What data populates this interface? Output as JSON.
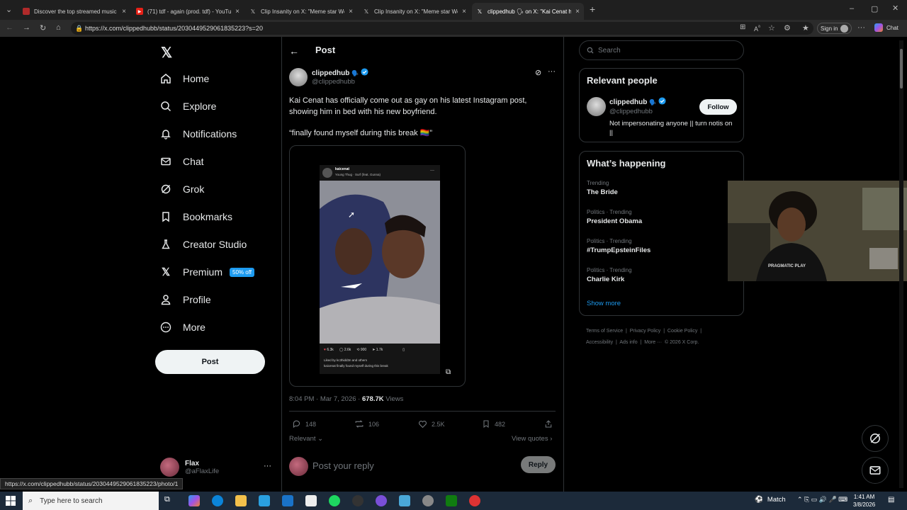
{
  "browser": {
    "tabs": [
      {
        "title": "Discover the top streamed music",
        "icon": "music-icon"
      },
      {
        "title": "(71) tdf - again (prod. tdf) - YouTu",
        "icon": "youtube-icon"
      },
      {
        "title": "Clip Insanity on X: \"Meme star We",
        "icon": "x-logo-icon"
      },
      {
        "title": "Clip Insanity on X: \"Meme star We",
        "icon": "x-logo-icon"
      },
      {
        "title": "clippedhub 🗣 on X: \"Kai Cenat h",
        "icon": "x-logo-icon"
      }
    ],
    "url": "https://x.com/clippedhubb/status/2030449529061835223?s=20",
    "signin_label": "Sign in",
    "chat_label": "Chat",
    "status_url": "https://x.com/clippedhubb/status/2030449529061835223/photo/1"
  },
  "nav": {
    "items": [
      {
        "label": "Home",
        "icon": "home-icon"
      },
      {
        "label": "Explore",
        "icon": "search-icon"
      },
      {
        "label": "Notifications",
        "icon": "bell-icon"
      },
      {
        "label": "Chat",
        "icon": "mail-icon"
      },
      {
        "label": "Grok",
        "icon": "grok-icon"
      },
      {
        "label": "Bookmarks",
        "icon": "bookmark-icon"
      },
      {
        "label": "Creator Studio",
        "icon": "flask-icon"
      },
      {
        "label": "Premium",
        "icon": "x-logo-icon",
        "badge": "50% off"
      },
      {
        "label": "Profile",
        "icon": "person-icon"
      },
      {
        "label": "More",
        "icon": "more-circle-icon"
      }
    ],
    "post_button": "Post",
    "account": {
      "name": "Flax",
      "handle": "@aFlaxLife"
    }
  },
  "post": {
    "header_title": "Post",
    "author_name": "clippedhub",
    "author_handle": "@clippedhubb",
    "text_1": "Kai Cenat has officially come out as gay on his latest Instagram post, showing him in bed with his new boyfriend.",
    "text_2": "“finally found myself during this break 🏳️‍🌈”",
    "image_caption": {
      "ig_user": "kaicenat",
      "ig_song": "Young Thug · Surf (feat. Gunna)",
      "likes": "6.3k",
      "comments": "2.6k",
      "reposts": "900",
      "sends": "1.7k",
      "liked_by": "Liked by kc3hidd3n and others",
      "ig_caption": "kaicenat finally found myself during this break"
    },
    "timestamp": "8:04 PM · Mar 7, 2026 · ",
    "views_count": "678.7K",
    "views_label": " Views",
    "replies": "148",
    "reposts": "106",
    "likes": "2.5K",
    "bookmarks": "482",
    "sort_label": "Relevant",
    "view_quotes": "View quotes",
    "reply_placeholder": "Post your reply",
    "reply_button": "Reply"
  },
  "sidebar": {
    "search_placeholder": "Search",
    "relevant_title": "Relevant people",
    "person": {
      "name": "clippedhub",
      "handle": "@clippedhubb",
      "bio": "Not impersonating anyone || turn notis on ||",
      "follow_label": "Follow"
    },
    "happening_title": "What’s happening",
    "trends": [
      {
        "category": "Trending",
        "name": "The Bride"
      },
      {
        "category": "Politics · Trending",
        "name": "President Obama"
      },
      {
        "category": "Politics · Trending",
        "name": "#TrumpEpsteinFiles"
      },
      {
        "category": "Politics · Trending",
        "name": "Charlie Kirk"
      }
    ],
    "show_more": "Show more",
    "footer": [
      "Terms of Service",
      "Privacy Policy",
      "Cookie Policy",
      "Accessibility",
      "Ads info",
      "More ···",
      "© 2026 X Corp."
    ]
  },
  "webcam": {
    "hoodie_text": "PRAGMATIC PLAY"
  },
  "taskbar": {
    "search_placeholder": "Type here to search",
    "weather": "Match",
    "time": "1:41 AM",
    "date": "3/8/2026"
  },
  "colors": {
    "accent": "#1d9bf0",
    "background": "#000000",
    "border": "#2f3336",
    "muted": "#71767b"
  }
}
